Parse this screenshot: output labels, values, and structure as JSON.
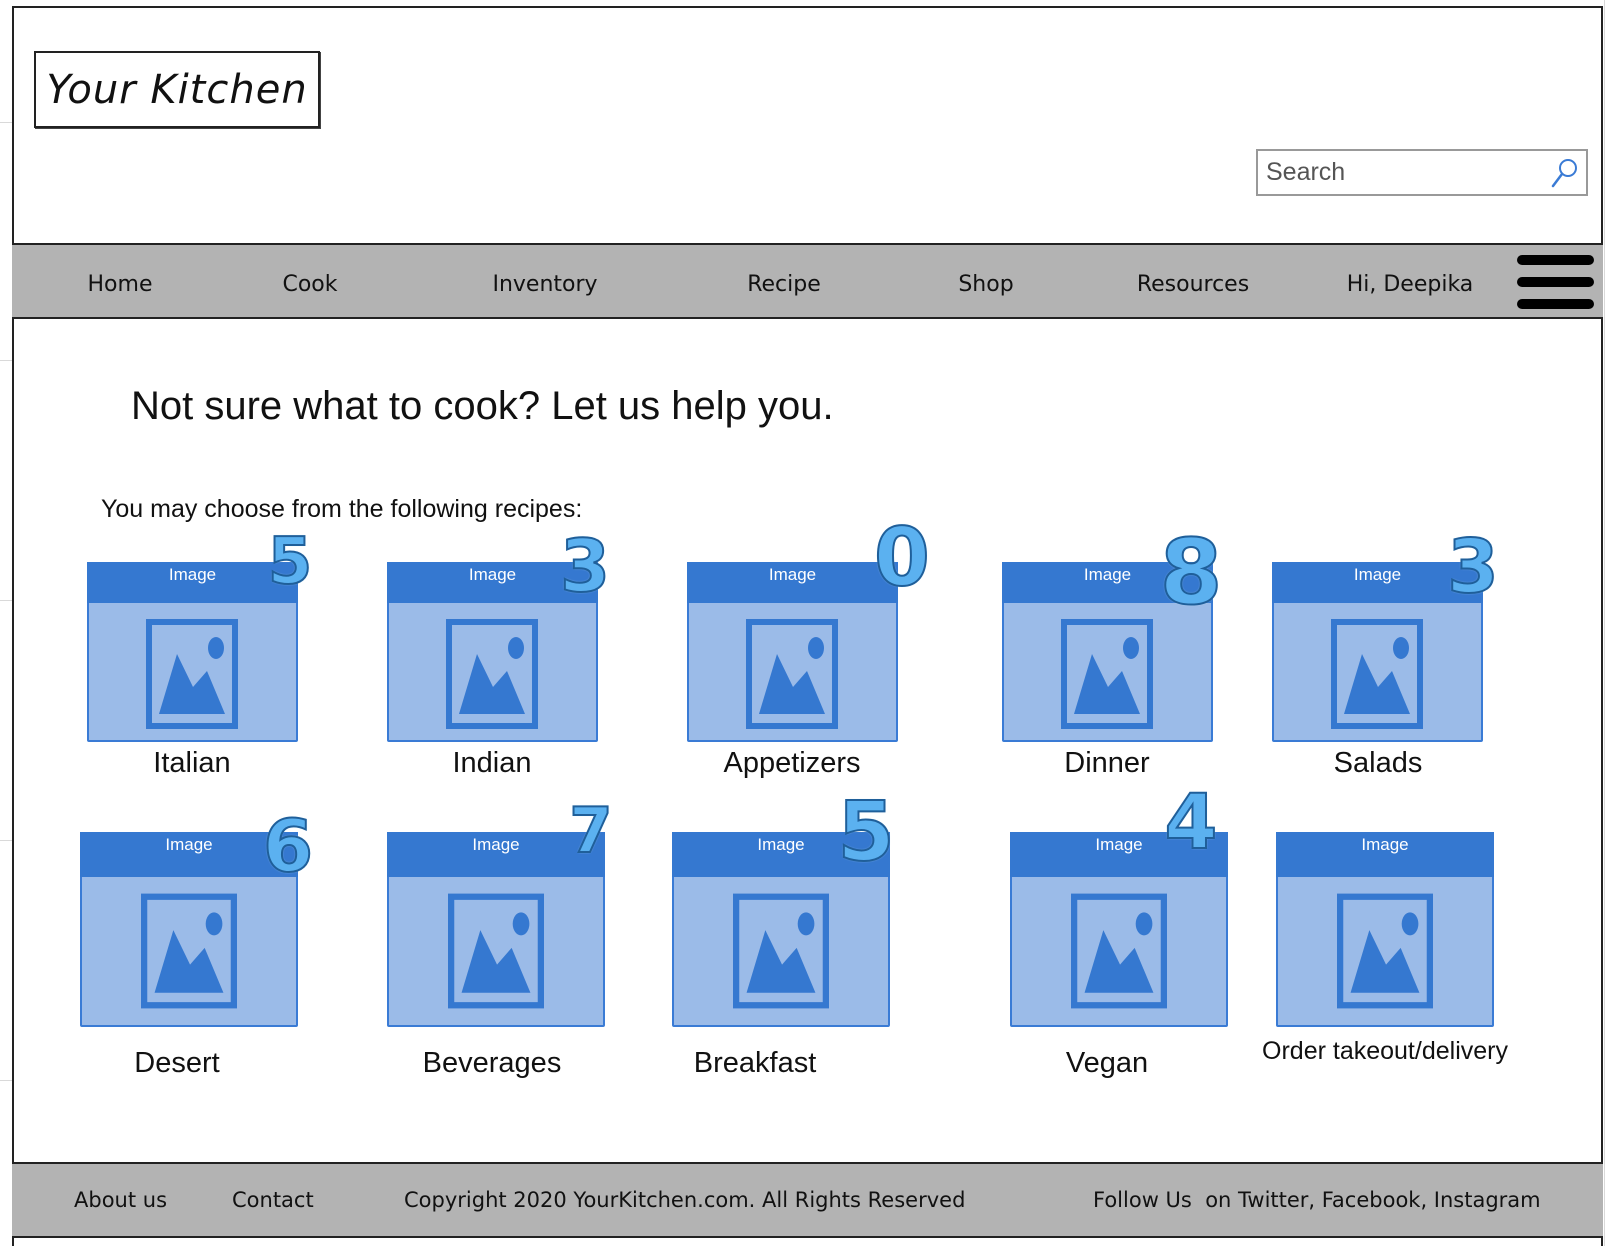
{
  "app": {
    "logo_text": "Your Kitchen"
  },
  "search": {
    "placeholder": "Search"
  },
  "nav": {
    "items": [
      "Home",
      "Cook",
      "Inventory",
      "Recipe",
      "Shop",
      "Resources",
      "Hi, Deepika"
    ]
  },
  "main": {
    "headline": "Not sure what to cook? Let us help you.",
    "subhead": "You may choose from the following recipes:"
  },
  "cards": [
    {
      "label": "Italian",
      "image_caption": "Image",
      "count": "5"
    },
    {
      "label": "Indian",
      "image_caption": "Image",
      "count": "3"
    },
    {
      "label": "Appetizers",
      "image_caption": "Image",
      "count": "0"
    },
    {
      "label": "Dinner",
      "image_caption": "Image",
      "count": "8"
    },
    {
      "label": "Salads",
      "image_caption": "Image",
      "count": "3"
    },
    {
      "label": "Desert",
      "image_caption": "Image",
      "count": "6"
    },
    {
      "label": "Beverages",
      "image_caption": "Image",
      "count": "7"
    },
    {
      "label": "Breakfast",
      "image_caption": "Image",
      "count": "5"
    },
    {
      "label": "Vegan",
      "image_caption": "Image",
      "count": "4"
    },
    {
      "label": "Order takeout/delivery",
      "image_caption": "Image",
      "count": ""
    }
  ],
  "footer": {
    "about": "About us",
    "contact": "Contact",
    "copyright": "Copyright 2020 YourKitchen.com. All Rights Reserved",
    "follow": "Follow Us  on Twitter, Facebook, Instagram"
  },
  "icons": {
    "search": "search-icon",
    "menu": "hamburger-menu-icon",
    "image_placeholder": "image-placeholder-icon"
  },
  "colors": {
    "nav_bg": "#b3b3b3",
    "card_fill": "#9bbbe8",
    "card_accent": "#3578d0",
    "count_fill": "#5bb1f0"
  }
}
